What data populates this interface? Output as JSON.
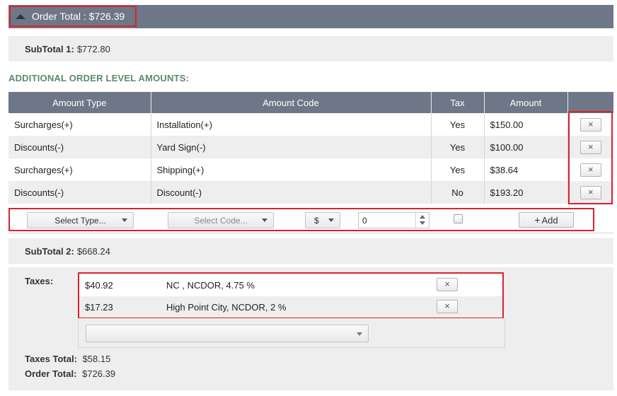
{
  "header": {
    "order_total_label": "Order Total : $726.39",
    "collapse_icon": "triangle-up-icon"
  },
  "subtotal1": {
    "label": "SubTotal 1:",
    "value": "$772.80"
  },
  "section_title": "ADDITIONAL ORDER LEVEL AMOUNTS:",
  "amounts_table": {
    "columns": [
      "Amount Type",
      "Amount Code",
      "Tax",
      "Amount",
      ""
    ],
    "rows": [
      {
        "type": "Surcharges(+)",
        "code": "Installation(+)",
        "tax": "Yes",
        "amount": "$150.00",
        "remove": "×"
      },
      {
        "type": "Discounts(-)",
        "code": "Yard Sign(-)",
        "tax": "Yes",
        "amount": "$100.00",
        "remove": "×"
      },
      {
        "type": "Surcharges(+)",
        "code": "Shipping(+)",
        "tax": "Yes",
        "amount": "$38.64",
        "remove": "×"
      },
      {
        "type": "Discounts(-)",
        "code": "Discount(-)",
        "tax": "No",
        "amount": "$193.20",
        "remove": "×"
      }
    ]
  },
  "add_row": {
    "type_select": "Select Type...",
    "code_select": "Select Code...",
    "unit_select": "$",
    "amount_value": "0",
    "tax_checked": false,
    "add_button": "Add",
    "add_icon": "+"
  },
  "subtotal2": {
    "label": "SubTotal 2:",
    "value": "$668.24"
  },
  "taxes": {
    "label": "Taxes:",
    "items": [
      {
        "amount": "$40.92",
        "description": "NC , NCDOR, 4.75 %",
        "remove": "×"
      },
      {
        "amount": "$17.23",
        "description": "High Point City, NCDOR, 2 %",
        "remove": "×"
      }
    ],
    "select_value": ""
  },
  "totals": {
    "taxes_total_label": "Taxes Total:",
    "taxes_total_value": "$58.15",
    "order_total_label": "Order Total:",
    "order_total_value": "$726.39"
  },
  "colors": {
    "header_bg": "#6e7787",
    "highlight": "#d9232e",
    "section_title": "#5b8a6a",
    "stripe": "#eeeeee"
  }
}
